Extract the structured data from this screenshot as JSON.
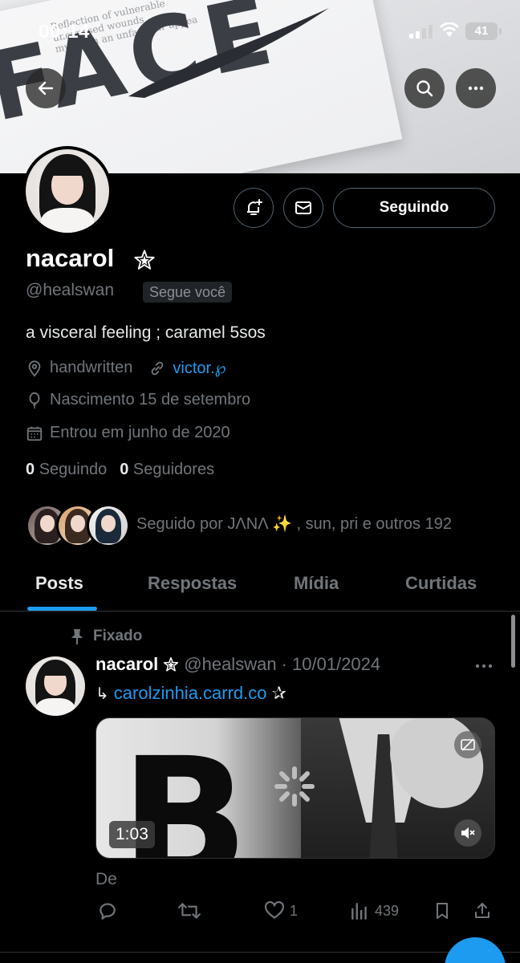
{
  "status_bar": {
    "time": "00:14",
    "battery": "41"
  },
  "profile": {
    "name": "nacarol",
    "handle": "@healswan",
    "follows_you": "Segue você",
    "bio": "a visceral feeling ; caramel 5sos",
    "location": "handwritten",
    "link": "victor.℘",
    "birthday": "Nascimento 15 de setembro",
    "joined": "Entrou em junho de 2020",
    "following_count": "0",
    "following_label": "Seguindo",
    "followers_count": "0",
    "followers_label": "Seguidores",
    "followed_by": "Seguido por JΛNΛ ✨ , sun, pri e outros 192",
    "follow_button": "Seguindo"
  },
  "tabs": [
    {
      "label": "Posts",
      "active": true
    },
    {
      "label": "Respostas",
      "active": false
    },
    {
      "label": "Mídia",
      "active": false
    },
    {
      "label": "Curtidas",
      "active": false
    }
  ],
  "post": {
    "pinned_label": "Fixado",
    "name": "nacarol",
    "handle": "@healswan",
    "date": "· 10/01/2024",
    "arrow": "↳",
    "link": "carolzinhia.carrd.co",
    "star": "✰",
    "video_duration": "1:03",
    "caption": "De",
    "likes": "1",
    "views": "439"
  },
  "colors": {
    "accent": "#1d9bf0",
    "background": "#000000",
    "muted": "#71767b"
  },
  "icons": [
    "back-arrow-icon",
    "search-icon",
    "more-icon",
    "bell-plus-icon",
    "mail-icon",
    "location-icon",
    "link-icon",
    "balloon-icon",
    "calendar-icon",
    "pin-icon",
    "reply-icon",
    "retweet-icon",
    "heart-icon",
    "views-icon",
    "bookmark-icon",
    "share-icon"
  ]
}
